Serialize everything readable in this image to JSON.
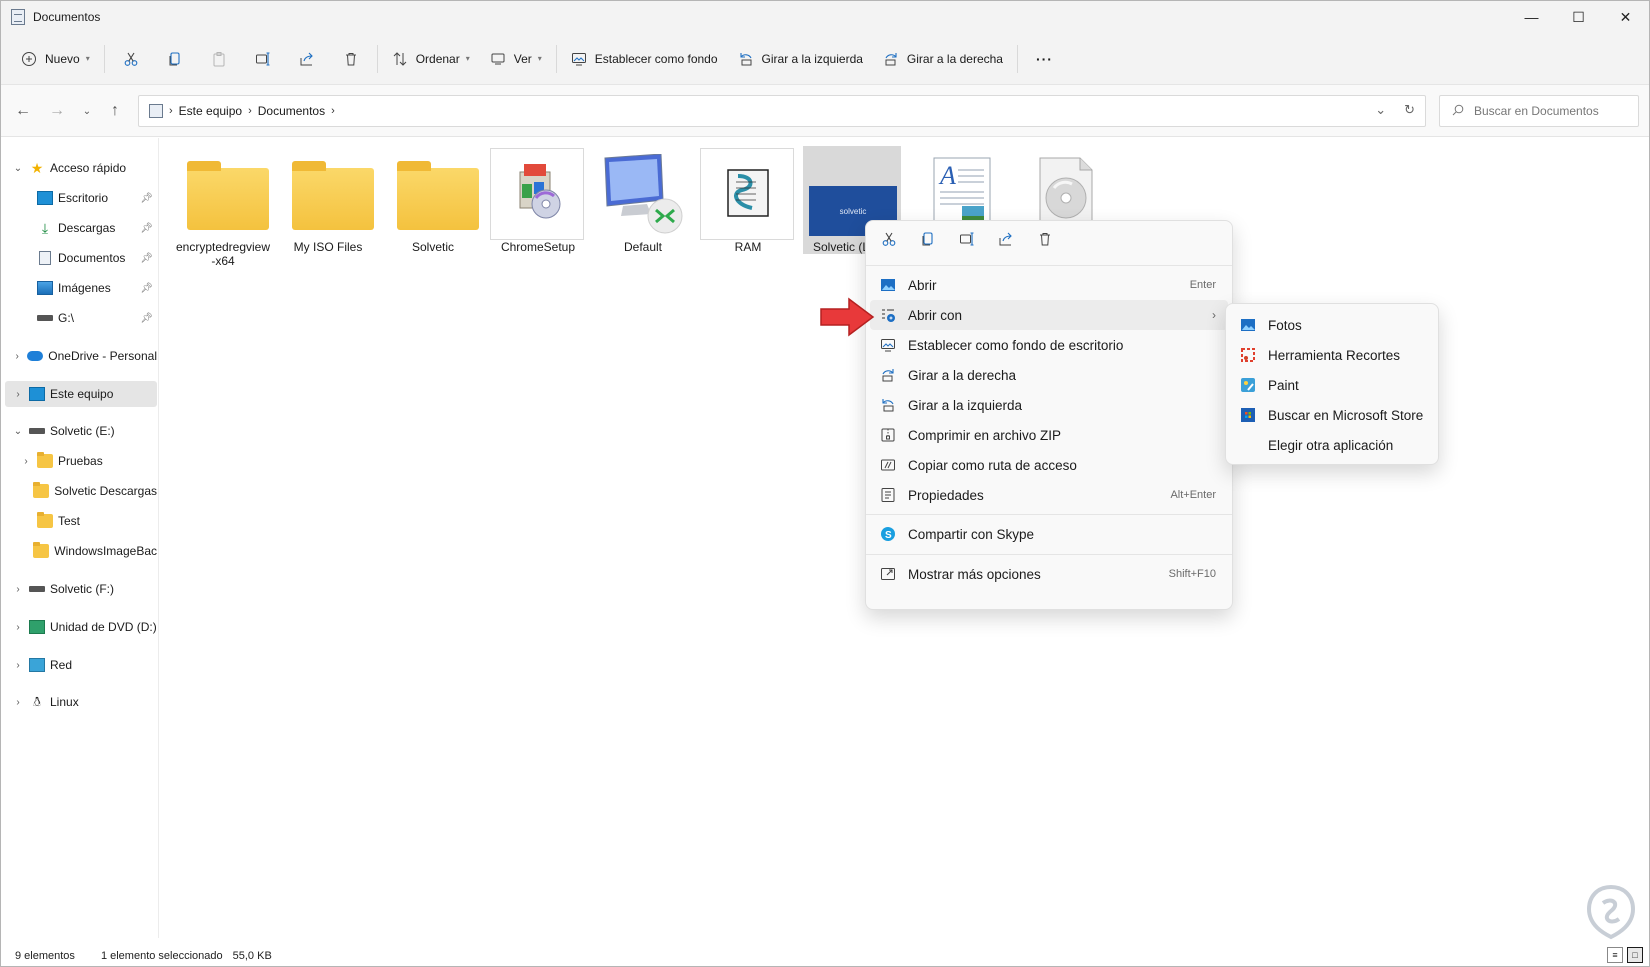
{
  "window": {
    "title": "Documentos"
  },
  "window_controls": {
    "minimize": "—",
    "maximize": "☐",
    "close": "✕"
  },
  "toolbar": {
    "new_label": "Nuevo",
    "sort_label": "Ordenar",
    "view_label": "Ver",
    "set_background_label": "Establecer como fondo",
    "rotate_left_label": "Girar a la izquierda",
    "rotate_right_label": "Girar a la derecha",
    "more_label": "···"
  },
  "address": {
    "crumbs": [
      "Este equipo",
      "Documentos"
    ],
    "search_placeholder": "Buscar en Documentos"
  },
  "sidebar": {
    "quick_access": "Acceso rápido",
    "items": [
      {
        "label": "Escritorio",
        "icon": "desktop-icon"
      },
      {
        "label": "Descargas",
        "icon": "download-icon"
      },
      {
        "label": "Documentos",
        "icon": "documents-icon"
      },
      {
        "label": "Imágenes",
        "icon": "pictures-icon"
      },
      {
        "label": "G:\\",
        "icon": "drive-icon"
      }
    ],
    "onedrive": "OneDrive - Personal",
    "this_pc": "Este equipo",
    "drive_e": "Solvetic (E:)",
    "e_children": [
      "Pruebas",
      "Solvetic Descargas",
      "Test",
      "WindowsImageBac"
    ],
    "drive_f": "Solvetic (F:)",
    "dvd": "Unidad de DVD (D:)",
    "network": "Red",
    "linux": "Linux"
  },
  "files": [
    {
      "name": "encryptedregview-x64",
      "type": "folder"
    },
    {
      "name": "My ISO Files",
      "type": "folder"
    },
    {
      "name": "Solvetic",
      "type": "folder"
    },
    {
      "name": "ChromeSetup",
      "type": "installer"
    },
    {
      "name": "Default",
      "type": "rdp"
    },
    {
      "name": "RAM",
      "type": "script"
    },
    {
      "name": "Solvetic (L",
      "type": "image",
      "thumb_text": "solvetic"
    },
    {
      "name": "",
      "type": "document"
    },
    {
      "name": "",
      "type": "disc-image"
    }
  ],
  "context_menu": {
    "items": [
      {
        "label": "Abrir",
        "accel": "Enter"
      },
      {
        "label": "Abrir con",
        "accel": ""
      },
      {
        "label": "Establecer como fondo de escritorio",
        "accel": ""
      },
      {
        "label": "Girar a la derecha",
        "accel": ""
      },
      {
        "label": "Girar a la izquierda",
        "accel": ""
      },
      {
        "label": "Comprimir en archivo ZIP",
        "accel": ""
      },
      {
        "label": "Copiar como ruta de acceso",
        "accel": ""
      },
      {
        "label": "Propiedades",
        "accel": "Alt+Enter"
      },
      {
        "label": "Compartir con Skype",
        "accel": ""
      },
      {
        "label": "Mostrar más opciones",
        "accel": "Shift+F10"
      }
    ]
  },
  "open_with_menu": {
    "items": [
      "Fotos",
      "Herramienta Recortes",
      "Paint",
      "Buscar en Microsoft Store",
      "Elegir otra aplicación"
    ]
  },
  "status": {
    "count": "9 elementos",
    "selection": "1 elemento seleccionado",
    "size": "55,0 KB"
  },
  "colors": {
    "accent": "#0067c0",
    "annotation_arrow": "#e8393a",
    "folder": "#f6c544"
  }
}
